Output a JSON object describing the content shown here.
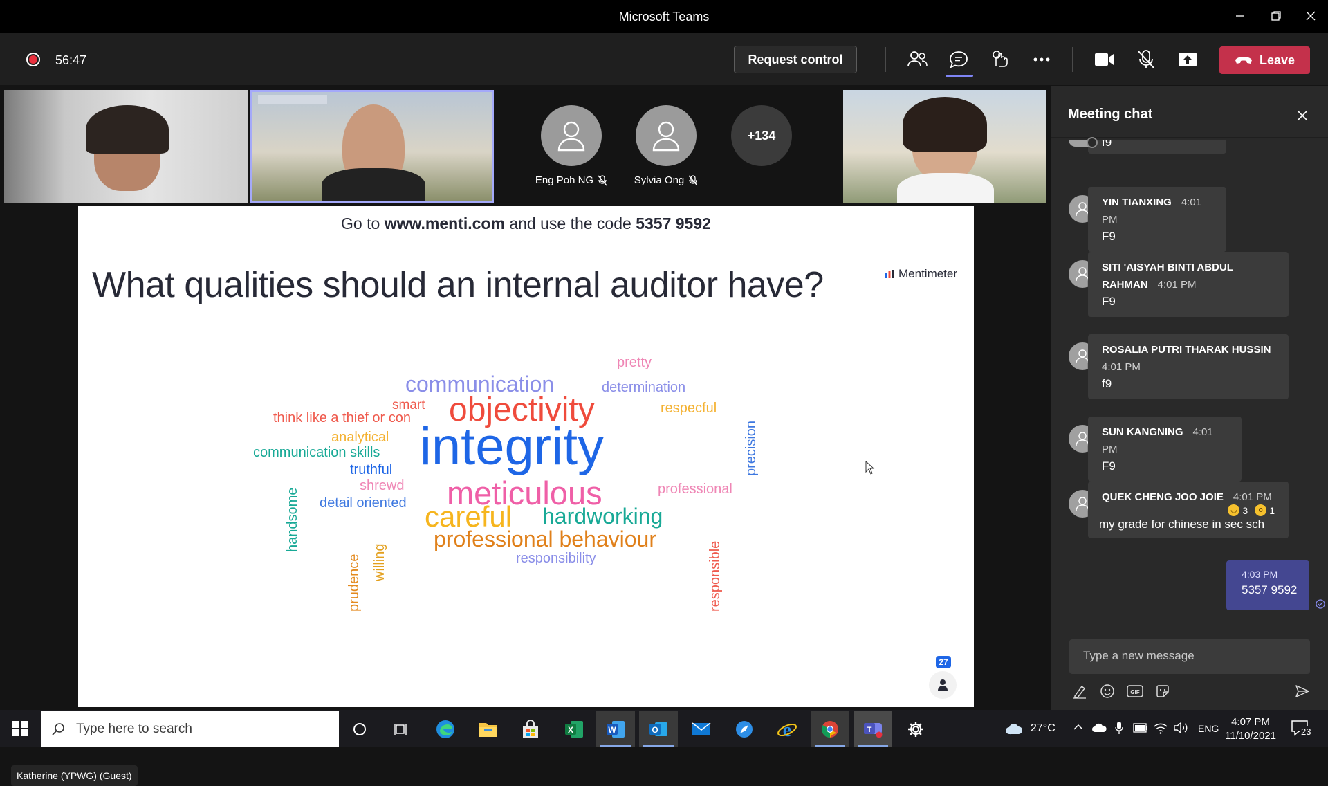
{
  "window": {
    "title": "Microsoft Teams"
  },
  "toolbar": {
    "timer": "56:47",
    "request_control_label": "Request control",
    "leave_label": "Leave"
  },
  "participants": {
    "tiles": [
      {
        "name": "Eng Poh NG"
      },
      {
        "name": "Sylvia Ong"
      }
    ],
    "more_count": "+134",
    "presenter_name_tag": "Katherine (YPWG) (Guest)"
  },
  "slide": {
    "code_prefix": "Go to",
    "code_url": "www.menti.com",
    "code_middle": "and use the code",
    "code_number": "5357 9592",
    "question": "What qualities should an internal auditor have?",
    "brand": "Mentimeter",
    "participant_count": "27",
    "word_cloud": [
      {
        "text": "pretty",
        "color": "#ef86b5"
      },
      {
        "text": "communication",
        "color": "#8a8ee8"
      },
      {
        "text": "determination",
        "color": "#8a8ee8"
      },
      {
        "text": "smart",
        "color": "#ef5a4d"
      },
      {
        "text": "objectivity",
        "color": "#ef4b3c"
      },
      {
        "text": "respecful",
        "color": "#f4b233"
      },
      {
        "text": "think like a thief or con",
        "color": "#ef5a4d"
      },
      {
        "text": "precision",
        "color": "#3e78e0"
      },
      {
        "text": "analytical",
        "color": "#f4b233"
      },
      {
        "text": "integrity",
        "color": "#1e66e6"
      },
      {
        "text": "communication skills",
        "color": "#18a996"
      },
      {
        "text": "truthful",
        "color": "#1e66e6"
      },
      {
        "text": "handsome",
        "color": "#18a996"
      },
      {
        "text": "shrewd",
        "color": "#ef86b5"
      },
      {
        "text": "meticulous",
        "color": "#ef5fa7"
      },
      {
        "text": "professional",
        "color": "#ef86b5"
      },
      {
        "text": "detail oriented",
        "color": "#3e78e0"
      },
      {
        "text": "careful",
        "color": "#f6b51e"
      },
      {
        "text": "hardworking",
        "color": "#18a996"
      },
      {
        "text": "prudence",
        "color": "#e38a1e"
      },
      {
        "text": "willing",
        "color": "#e3a01e"
      },
      {
        "text": "professional behaviour",
        "color": "#e0801a"
      },
      {
        "text": "responsible",
        "color": "#ef5a4d"
      },
      {
        "text": "responsibility",
        "color": "#8a8ee8"
      }
    ]
  },
  "chat": {
    "title": "Meeting chat",
    "partial_top_message": "f9",
    "messages": [
      {
        "sender": "YIN TIANXING",
        "time": "4:01 PM",
        "text": "F9"
      },
      {
        "sender": "SITI 'AISYAH BINTI ABDUL",
        "sender_line2": "RAHMAN",
        "time": "4:01 PM",
        "text": "F9"
      },
      {
        "sender": "ROSALIA PUTRI THARAK HUSSIN",
        "time": "4:01 PM",
        "text": "f9"
      },
      {
        "sender": "SUN KANGNING",
        "time": "4:01 PM",
        "text": "F9"
      },
      {
        "sender": "QUEK CHENG JOO JOIE",
        "time": "4:01 PM",
        "text": "my grade for chinese in sec sch",
        "reactions": [
          {
            "icon": "laugh-emoji-icon",
            "count": "3"
          },
          {
            "icon": "surprised-emoji-icon",
            "count": "1"
          }
        ]
      }
    ],
    "own_message": {
      "time": "4:03 PM",
      "text": "5357 9592"
    },
    "compose_placeholder": "Type a new message"
  },
  "taskbar": {
    "search_placeholder": "Type here to search",
    "weather": "27°C",
    "language": "ENG",
    "time": "4:07 PM",
    "date": "11/10/2021",
    "notification_count": "23"
  }
}
